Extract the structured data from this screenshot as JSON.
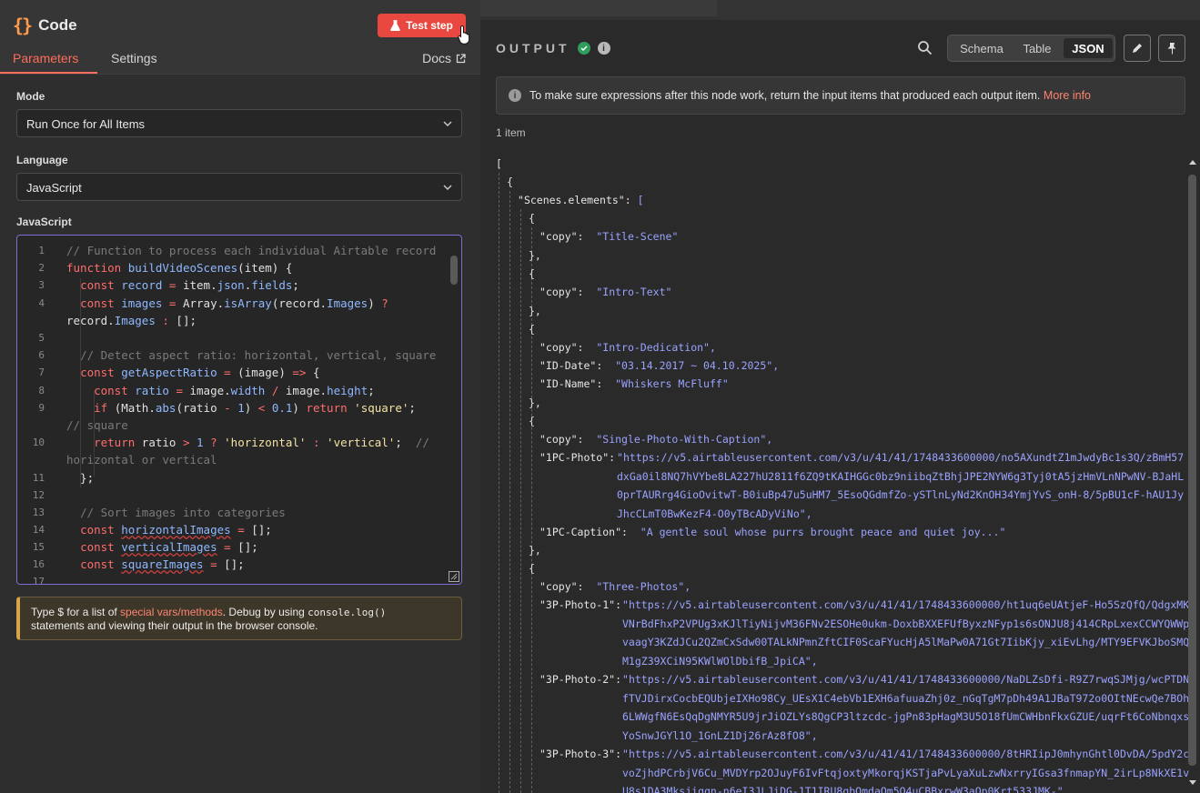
{
  "node": {
    "title": "Code",
    "test_step_label": "Test step",
    "tabs": [
      "Parameters",
      "Settings"
    ],
    "docs_label": "Docs"
  },
  "params": {
    "mode_label": "Mode",
    "mode_value": "Run Once for All Items",
    "language_label": "Language",
    "language_value": "JavaScript",
    "code_label": "JavaScript"
  },
  "hint": {
    "prefix": "Type $ for a list of ",
    "link": "special vars/methods",
    "middle": ". Debug by using ",
    "code": "console.log()",
    "suffix": "statements and viewing their output in the browser console."
  },
  "output": {
    "title": "OUTPUT",
    "views": [
      "Schema",
      "Table",
      "JSON"
    ],
    "active_view": "JSON",
    "banner_text": "To make sure expressions after this node work, return the input items that produced each output item.",
    "banner_link": "More info",
    "item_count": "1 item"
  },
  "code_lines": [
    "1",
    "2",
    "3",
    "4",
    "",
    "5",
    "6",
    "7",
    "8",
    "9",
    "",
    "10",
    "",
    "11",
    "12",
    "13",
    "14",
    "15",
    "16",
    "17"
  ],
  "json_view": {
    "root_key": "Scenes.elements",
    "scenes": [
      {
        "copy": "Title-Scene"
      },
      {
        "copy": "Intro-Text"
      },
      {
        "copy": "Intro-Dedication",
        "ID-Date": "03.14.2017 ~ 04.10.2025",
        "ID-Name": "Whiskers McFluff"
      },
      {
        "copy": "Single-Photo-With-Caption",
        "1PC-Photo": "https://v5.airtableusercontent.com/v3/u/41/41/1748433600000/no5AXundtZ1mJwdyBc1s3Q/zBmH57dxGa0il8NQ7hVYbe8LA227hU2811f6ZQ9tKAIHGGc0bz9niibqZtBhjJPE2NYW6g3Tyj0tA5jzHmVLnNPwNV-BJaHL0prTAURrg4GioOvitwT-B0iuBp47u5uHM7_5EsoQGdmfZo-ySTlnLyNd2KnOH34YmjYvS_onH-8/5pBU1cF-hAU1JyJhcCLmT0BwKezF4-O0yTBcADyViNo",
        "1PC-Caption": "A gentle soul whose purrs brought peace and quiet joy..."
      },
      {
        "copy": "Three-Photos",
        "3P-Photo-1": "https://v5.airtableusercontent.com/v3/u/41/41/1748433600000/ht1uq6eUAtjeF-Ho5SzQfQ/QdgxMKVNrBdFhxP2VPUg3xKJlTiyNijvM36FNv2ESOHe0ukm-DoxbBXXEFUfByxzNFyp1s6sONJU8j414CRpLxexCCWYQWWpvaagY3KZdJCu2QZmCxSdw00TALkNPmnZftCIF0ScaFYucHjA5lMaPw0A71Gt7IibKjy_xiEvLhg/MTY9EFVKJboSMQM1gZ39XCiN95KWlWOlDbifB_JpiCA",
        "3P-Photo-2": "https://v5.airtableusercontent.com/v3/u/41/41/1748433600000/NaDLZsDfi-R9Z7rwqSJMjg/wcPTDNfTVJDirxCocbEQUbjeIXHo98Cy_UEsX1C4ebVb1EXH6afuuaZhj0z_nGqTgM7pDh49A1JBaT972o0OItNEcwQe7BOh6LWWgfN6EsQqDgNMYR5U9jrJiOZLYs8QgCP3ltzcdc-jgPn83pHagM3U5O18fUmCWHbnFkxGZUE/uqrFt6CoNbnqxsYoSnwJGYl1O_1GnLZ1Dj26rAz8fO8",
        "3P-Photo-3": "https://v5.airtableusercontent.com/v3/u/41/41/1748433600000/8tHRIipJ0mhynGhtl0DvDA/5pdY2cvoZjhdPCrbjV6Cu_MVDYrp2OJuyF6IvFtqjoxtyMkorqjKSTjaPvLyaXuLzwNxrryIGsa3fnmapYN_2irLp8NkXE1vU8s1DA3Mksjigqn-n6eI3JLJiDG-1T1IRU8gbOmdaOm5O4uCBBxrwW3aQp0Krt533JMK-"
      }
    ]
  },
  "colors": {
    "accent": "#ff6d5a",
    "test_button": "#e8483f",
    "success": "#2f9e5a",
    "json_string": "#9aa3ff"
  }
}
